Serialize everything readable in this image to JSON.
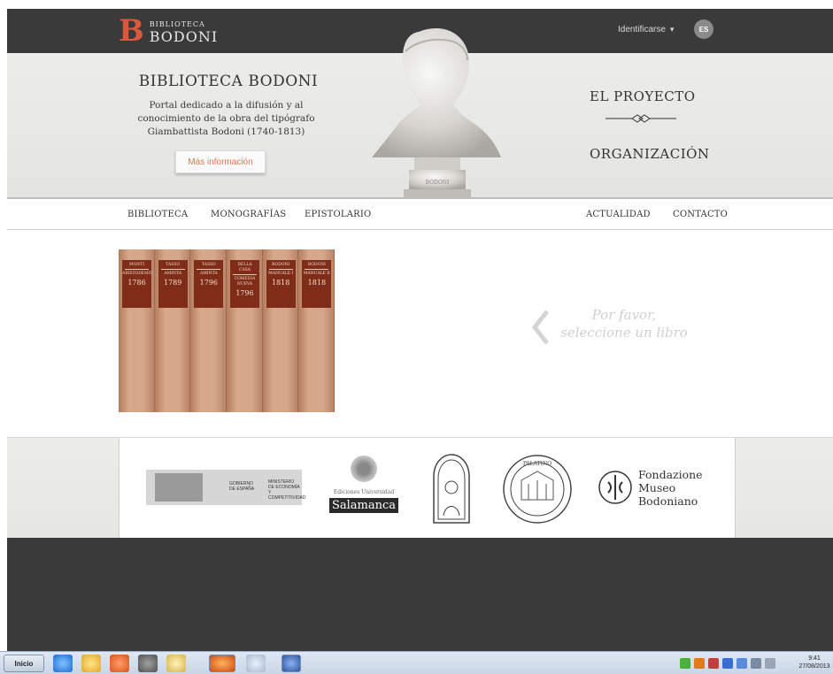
{
  "topbar": {
    "logo_letter": "B",
    "logo_small": "BIBLIOTECA",
    "logo_big": "BODONI",
    "login_label": "Identificarse",
    "lang": "ES"
  },
  "hero": {
    "title": "BIBLIOTECA BODONI",
    "description": "Portal dedicado a la difusión y al conocimiento de la obra del tipógrafo Giambattista Bodoni (1740-1813)",
    "more_button": "Más información",
    "link_project": "EL PROYECTO",
    "link_organization": "ORGANIZACIÓN",
    "bust_plinth_text": "BODONI"
  },
  "nav": {
    "items": [
      "BIBLIOTECA",
      "MONOGRAFÍAS",
      "EPISTOLARIO",
      "ACTUALIDAD",
      "CONTACTO"
    ]
  },
  "books": [
    {
      "author": "MONTI",
      "title": "ARISTODEMO",
      "year": "1786"
    },
    {
      "author": "TASSO",
      "title": "AMINTA",
      "year": "1789"
    },
    {
      "author": "TASSO",
      "title": "AMINTA",
      "year": "1796"
    },
    {
      "author": "DELLA CASA",
      "title": "COMEDIA NUEVA",
      "year": "1796"
    },
    {
      "author": "BODONI",
      "title": "MANUALE I",
      "year": "1818"
    },
    {
      "author": "BODONI",
      "title": "MANUALE II",
      "year": "1818"
    }
  ],
  "selection_message": "Por favor, seleccione un libro",
  "sponsors": {
    "gov_line1": "GOBIERNO",
    "gov_line2": "DE ESPAÑA",
    "gov_line3": "MINISTERIO",
    "gov_line4": "DE ECONOMÍA",
    "gov_line5": "Y COMPETITIVIDAD",
    "salamanca_small": "Ediciones Universidad",
    "salamanca_big": "Salamanca",
    "seal_text": "PALATINO",
    "fmb_line1": "Fondazione",
    "fmb_line2": "Museo",
    "fmb_line3": "Bodoniano"
  },
  "taskbar": {
    "start_label": "Inicio",
    "time": "9:41",
    "date": "27/08/2013"
  },
  "colors": {
    "accent": "#d8593c",
    "dark_bar": "#3a3a3a",
    "book_label": "#7f2c18"
  }
}
